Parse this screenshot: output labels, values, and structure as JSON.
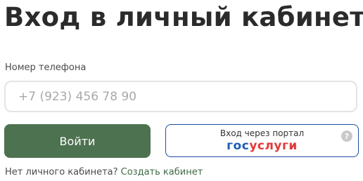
{
  "header": {
    "title": "Вход в личный кабинет"
  },
  "phone": {
    "label": "Номер телефона",
    "placeholder": "+7 (923) 456 78 90",
    "value": ""
  },
  "buttons": {
    "login_label": "Войти",
    "gosuslugi_caption": "Вход через портал",
    "gosuslugi_logo_part1": "гос",
    "gosuslugi_logo_part2": "услуги",
    "help_icon": "question-circle-icon"
  },
  "footer": {
    "prompt": "Нет личного кабинета?",
    "link": "Создать кабинет"
  },
  "colors": {
    "primary_button": "#4d7250",
    "link": "#3f6a45",
    "gosuslugi_border": "#1d4fa0",
    "gosuslugi_blue": "#1e5bb8",
    "gosuslugi_red": "#e13a3a"
  }
}
